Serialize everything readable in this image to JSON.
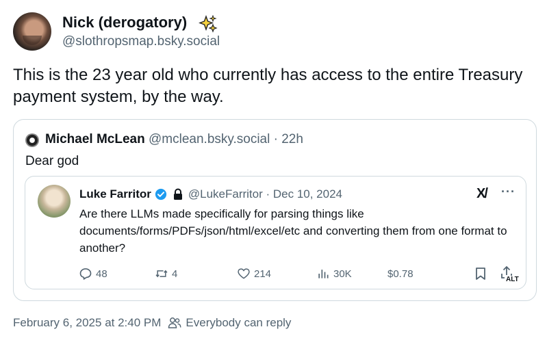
{
  "post": {
    "author_name": "Nick (derogatory)",
    "author_handle": "@slothropsmap.bsky.social",
    "text": "This is the 23 year old who currently has access to the entire Treasury payment system, by the way.",
    "timestamp": "February 6, 2025 at 2:40 PM",
    "reply_setting": "Everybody can reply"
  },
  "quote": {
    "author_name": "Michael McLean",
    "author_handle": "@mclean.bsky.social",
    "separator": " · ",
    "age": "22h",
    "text": "Dear god"
  },
  "embedded_tweet": {
    "author_name": "Luke Farritor",
    "author_handle": "@LukeFarritor · Dec 10, 2024",
    "text": "Are there LLMs made specifically for parsing things like documents/forms/PDFs/json/html/excel/etc and converting them from one format to another?",
    "grok_label": "X/",
    "more_label": "···",
    "stats": {
      "replies": "48",
      "reposts": "4",
      "likes": "214",
      "views": "30K",
      "price": "$0.78"
    },
    "alt_badge": "ALT"
  },
  "icons": {
    "sparkle": "sparkles-icon",
    "verified": "verified-badge-icon",
    "lock": "lock-icon",
    "reply": "reply-icon",
    "repost": "repost-icon",
    "like": "heart-icon",
    "views": "views-icon",
    "bookmark": "bookmark-icon",
    "share": "share-icon",
    "people": "people-icon"
  },
  "colors": {
    "text": "#0f1419",
    "secondary": "#536471",
    "border": "#cfd9de",
    "verified": "#1d9bf0",
    "sparkle": "#f4d03f"
  }
}
